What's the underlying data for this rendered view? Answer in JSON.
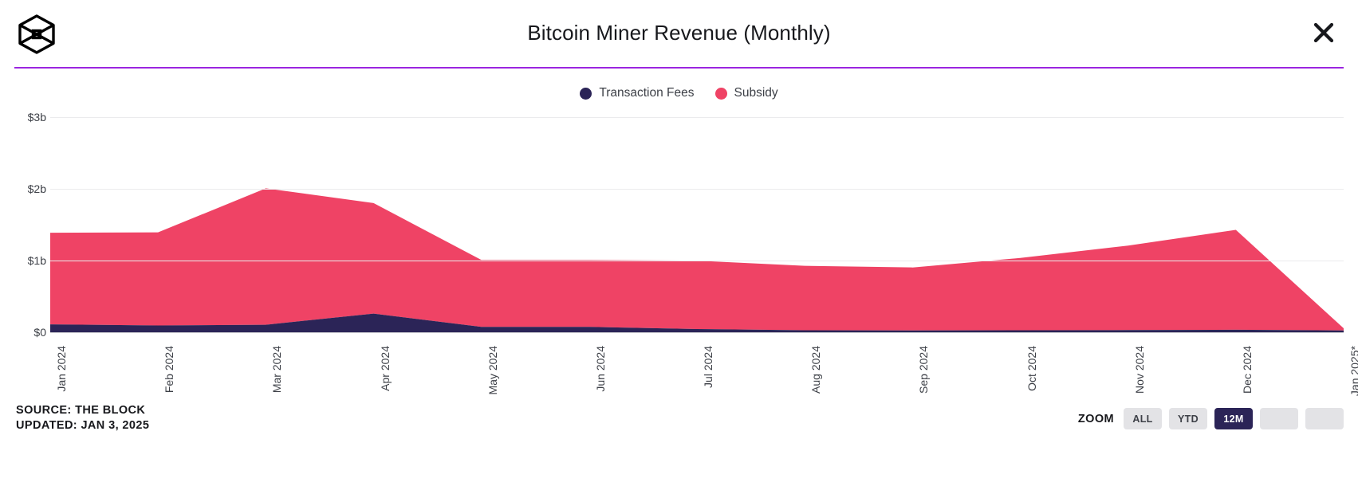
{
  "header": {
    "logo_icon": "the-block-cube-logo",
    "title": "Bitcoin Miner Revenue (Monthly)",
    "close_icon": "close-icon",
    "rule_color": "#9b25e0"
  },
  "legend": {
    "items": [
      {
        "label": "Transaction Fees",
        "color": "#2b2457"
      },
      {
        "label": "Subsidy",
        "color": "#ef4365"
      }
    ]
  },
  "footer": {
    "source": "SOURCE: THE BLOCK",
    "updated": "UPDATED: JAN 3, 2025",
    "zoom_label": "ZOOM",
    "zoom_buttons": [
      {
        "label": "ALL",
        "active": false
      },
      {
        "label": "YTD",
        "active": false
      },
      {
        "label": "12M",
        "active": true
      },
      {
        "label": "",
        "active": false
      },
      {
        "label": "",
        "active": false
      }
    ]
  },
  "chart_data": {
    "type": "area",
    "stacked": true,
    "title": "Bitcoin Miner Revenue (Monthly)",
    "xlabel": "",
    "ylabel": "",
    "ylim": [
      0,
      3300000000
    ],
    "yticks": [
      0,
      1000000000,
      2000000000,
      3000000000
    ],
    "ytick_labels": [
      "$0",
      "$1b",
      "$2b",
      "$3b"
    ],
    "grid": true,
    "legend_position": "top-center",
    "categories": [
      "Jan 2024",
      "Feb 2024",
      "Mar 2024",
      "Apr 2024",
      "May 2024",
      "Jun 2024",
      "Jul 2024",
      "Aug 2024",
      "Sep 2024",
      "Oct 2024",
      "Nov 2024",
      "Dec 2024",
      "Jan 2025*"
    ],
    "series": [
      {
        "name": "Transaction Fees",
        "color": "#2b2457",
        "values": [
          110000000,
          95000000,
          105000000,
          260000000,
          75000000,
          75000000,
          45000000,
          28000000,
          25000000,
          28000000,
          30000000,
          35000000,
          25000000
        ]
      },
      {
        "name": "Subsidy",
        "color": "#ef4365",
        "values": [
          1280000000,
          1300000000,
          1905000000,
          1545000000,
          935000000,
          935000000,
          955000000,
          900000000,
          880000000,
          1010000000,
          1180000000,
          1395000000,
          30000000
        ]
      }
    ],
    "totals": [
      1390000000,
      1395000000,
      2010000000,
      1805000000,
      1010000000,
      1010000000,
      1000000000,
      928000000,
      905000000,
      1038000000,
      1210000000,
      1430000000,
      55000000
    ]
  }
}
